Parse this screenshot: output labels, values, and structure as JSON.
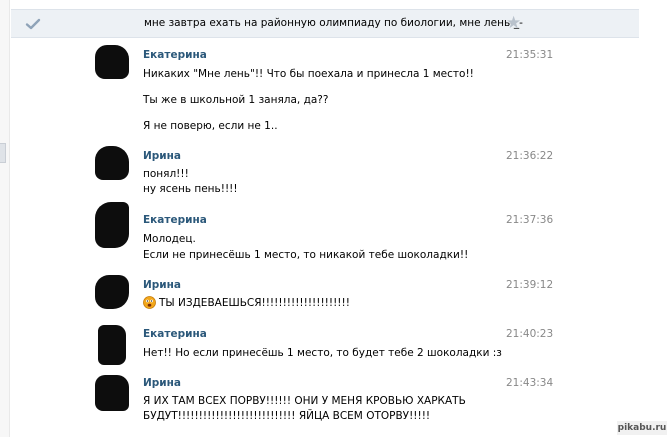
{
  "topic": "мне завтра ехать на районную олимпиаду по биологии, мне лень-_-",
  "icons": {
    "check": "check-icon",
    "star": "star-icon",
    "emoji": "shocked-face-icon"
  },
  "colors": {
    "author": "#2b587a",
    "time": "#888888",
    "topbar": "#edf1f5"
  },
  "messages": [
    {
      "author": "Екатерина",
      "time": "21:35:31",
      "lines": [
        "Никаких \"Мне лень\"!! Что бы поехала и принесла 1 место!!",
        "Ты же в школьной 1 заняла, да??",
        "Я не поверю, если не 1.."
      ]
    },
    {
      "author": "Ирина",
      "time": "21:36:22",
      "lines": [
        "понял!!!",
        "ну ясень пень!!!!"
      ]
    },
    {
      "author": "Екатерина",
      "time": "21:37:36",
      "lines": [
        "Молодец.",
        "Если не принесёшь 1 место, то никакой тебе шоколадки!!"
      ]
    },
    {
      "author": "Ирина",
      "time": "21:39:12",
      "lines": [
        "ТЫ ИЗДЕВАЕШЬСЯ!!!!!!!!!!!!!!!!!!!!!"
      ]
    },
    {
      "author": "Екатерина",
      "time": "21:40:23",
      "lines": [
        "Нет!! Но если принесёшь 1 место, то будет тебе 2 шоколадки :з"
      ]
    },
    {
      "author": "Ирина",
      "time": "21:43:34",
      "lines": [
        "Я ИХ ТАМ ВСЕХ ПОРВУ!!!!!! ОНИ У МЕНЯ КРОВЬЮ ХАРКАТЬ",
        "БУДУТ!!!!!!!!!!!!!!!!!!!!!!!!!!!! ЯЙЦА ВСЕМ ОТОРВУ!!!!!"
      ]
    }
  ],
  "watermark": "pikabu.ru"
}
